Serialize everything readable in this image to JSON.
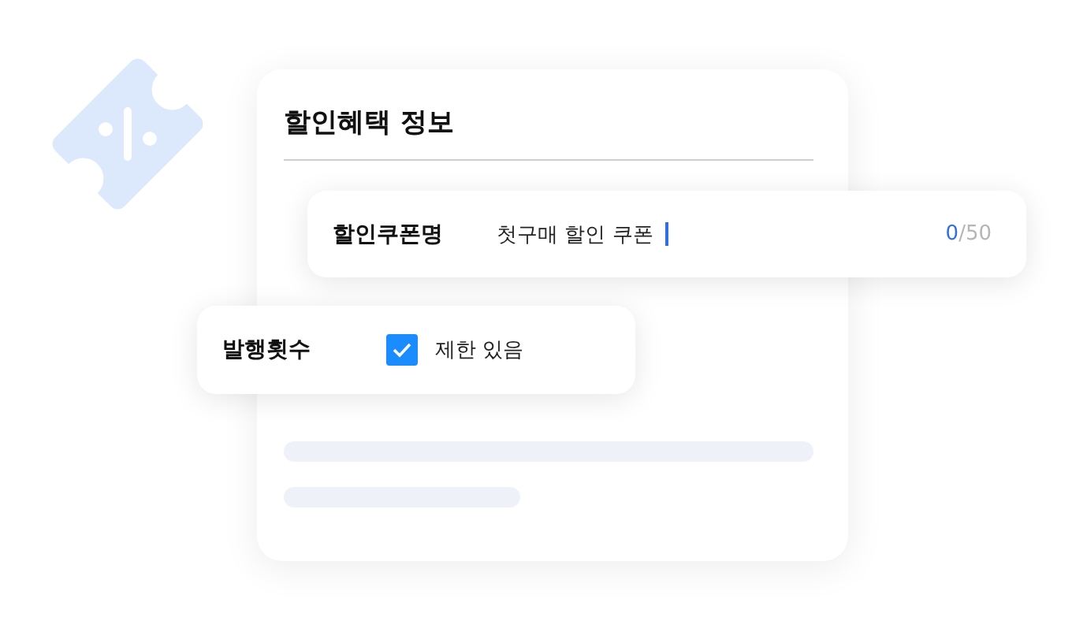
{
  "panel": {
    "title": "할인혜택 정보"
  },
  "coupon_name": {
    "label": "할인쿠폰명",
    "value": "첫구매 할인 쿠폰",
    "count": "0",
    "max": "/50"
  },
  "issue_count": {
    "label": "발행횟수",
    "checkbox": {
      "label": "제한 있음",
      "checked": true
    }
  }
}
